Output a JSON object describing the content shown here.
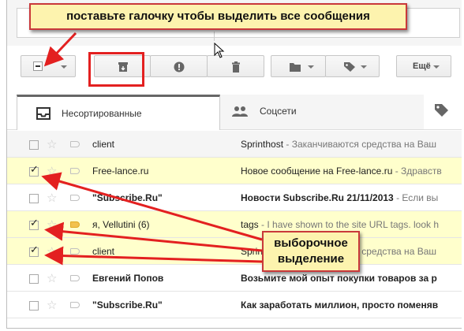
{
  "toolbar": {
    "more_label": "Ещё"
  },
  "tabs": [
    {
      "label": "Несортированные",
      "icon": "inbox-icon"
    },
    {
      "label": "Соцсети",
      "icon": "people-icon"
    }
  ],
  "emails": [
    {
      "sender": "client",
      "subject": "Sprinthost",
      "snippet": " - Заканчиваются средства на Ваш",
      "checked": false,
      "state": "read"
    },
    {
      "sender": "Free-lance.ru",
      "subject": "Новое сообщение на Free-lance.ru",
      "snippet": " - Здравств",
      "checked": true,
      "state": "selected"
    },
    {
      "sender": "\"Subscribe.Ru\"",
      "subject": "Новости Subscribe.Ru 21/11/2013",
      "snippet": " - Если вы",
      "checked": false,
      "state": "unread"
    },
    {
      "sender": "я, Vellutini (6)",
      "subject": "tags",
      "snippet": " - I have shown to the site URL tags. look h",
      "checked": true,
      "state": "selected"
    },
    {
      "sender": "client",
      "subject": "Sprinthost",
      "snippet": " - Заканчиваются средства на Ваш",
      "checked": true,
      "state": "selected"
    },
    {
      "sender": "Евгений Попов",
      "subject": "Возьмите мой опыт покупки товаров за р",
      "snippet": "",
      "checked": false,
      "state": "unread"
    },
    {
      "sender": "\"Subscribe.Ru\"",
      "subject": "Как заработать миллион, просто поменяв",
      "snippet": "",
      "checked": false,
      "state": "unread"
    }
  ],
  "annotations": {
    "top": "поставьте галочку чтобы выделить все сообщения",
    "selective_line1": "выборочное",
    "selective_line2": "выделение"
  },
  "colors": {
    "annotation_bg": "#fdf3ae",
    "annotation_border": "#c9383a",
    "arrow": "#e32020",
    "selected_row": "#ffffcc"
  }
}
